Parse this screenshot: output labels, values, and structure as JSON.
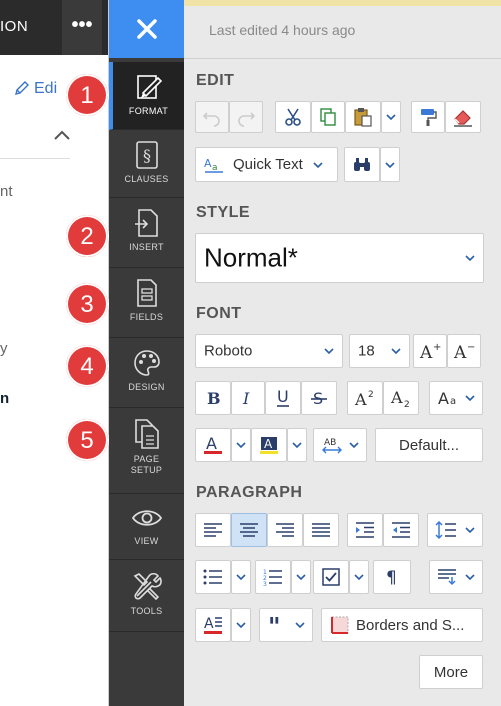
{
  "doc_pane": {
    "tab_text": "ION",
    "more_glyph": "•••",
    "edit_label": "Edi",
    "text_lines": [
      "nt",
      "y",
      "n"
    ]
  },
  "sidebar": {
    "items": [
      {
        "label": "FORMAT",
        "icon": "format-brush-icon"
      },
      {
        "label": "CLAUSES",
        "icon": "clauses-section-icon"
      },
      {
        "label": "INSERT",
        "icon": "insert-document-icon"
      },
      {
        "label": "FIELDS",
        "icon": "fields-form-icon"
      },
      {
        "label": "DESIGN",
        "icon": "design-palette-icon"
      },
      {
        "label": "PAGE\nSETUP",
        "label_l1": "PAGE",
        "label_l2": "SETUP",
        "icon": "page-setup-icon"
      },
      {
        "label": "VIEW",
        "icon": "view-eye-icon"
      },
      {
        "label": "TOOLS",
        "icon": "tools-wrench-icon"
      }
    ]
  },
  "steps": [
    "1",
    "2",
    "3",
    "4",
    "5"
  ],
  "panel": {
    "last_edited": "Last edited 4 hours ago",
    "edit": {
      "title": "EDIT",
      "quick_text": "Quick Text"
    },
    "style": {
      "title": "STYLE",
      "value": "Normal*"
    },
    "font": {
      "title": "FONT",
      "family": "Roboto",
      "size": "18",
      "default_label": "Default..."
    },
    "paragraph": {
      "title": "PARAGRAPH",
      "borders_label": "Borders and S...",
      "more_label": "More"
    }
  },
  "colors": {
    "accent": "#3e8ef2",
    "sidebar_bg": "#3a3a3a",
    "step_red": "#e23b3b",
    "panel_bg": "#e9e9e9"
  }
}
